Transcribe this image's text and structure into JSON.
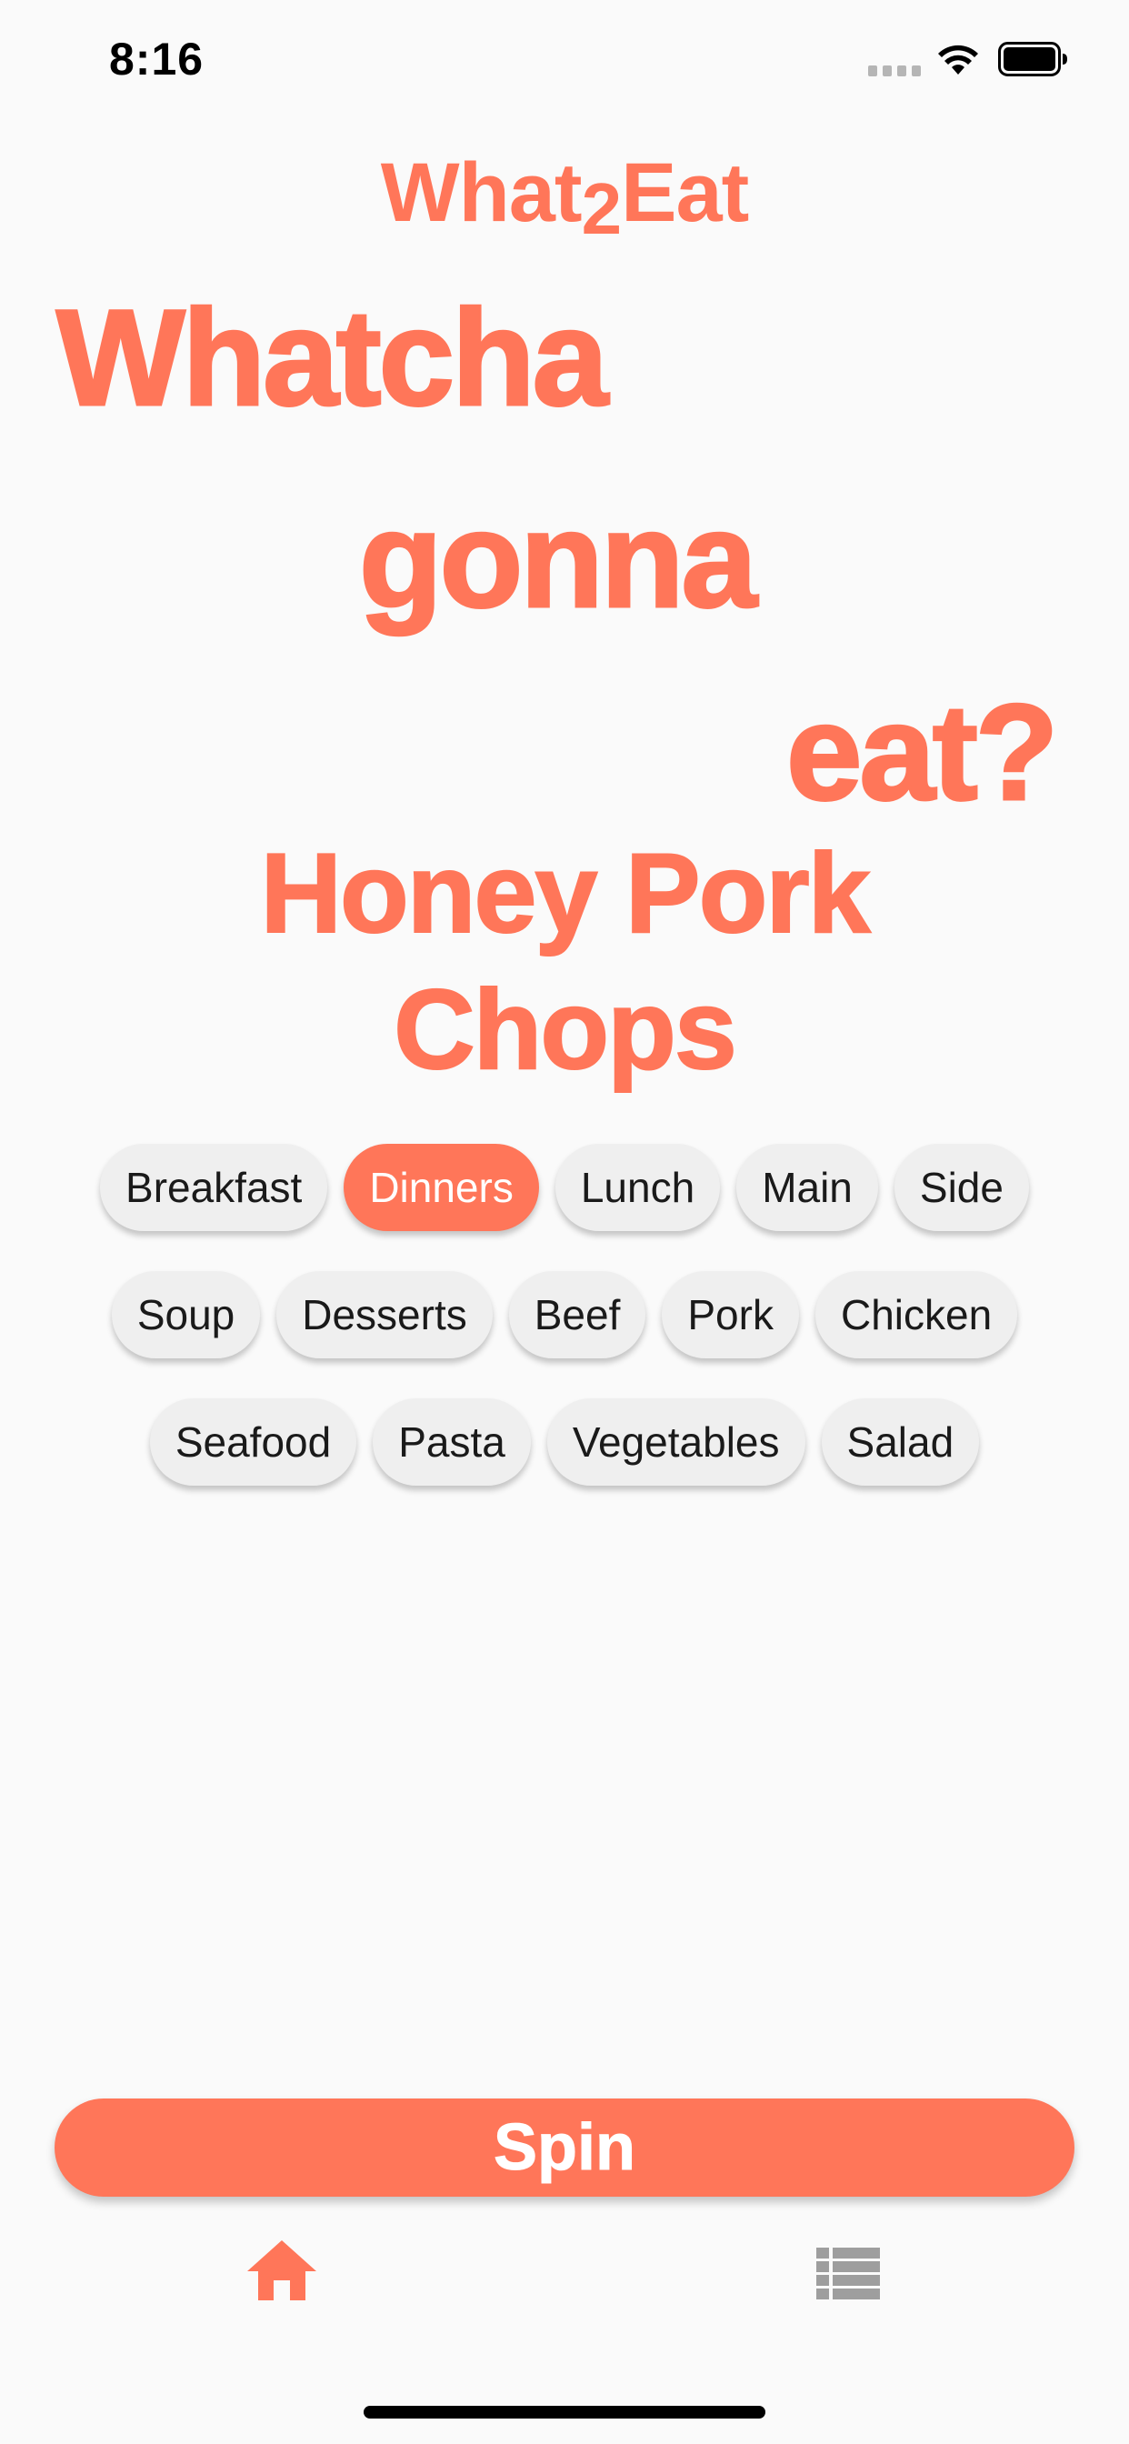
{
  "status_bar": {
    "time": "8:16"
  },
  "app": {
    "logo_left": "What",
    "logo_mid": "2",
    "logo_right": "Eat",
    "accent_color": "#ff7659"
  },
  "headline": {
    "line1": "Whatcha",
    "line2": "gonna",
    "line3": "eat?"
  },
  "result": {
    "line1": "Honey Pork",
    "line2": "Chops"
  },
  "categories": {
    "row1": [
      "Breakfast",
      "Dinners",
      "Lunch",
      "Main",
      "Side"
    ],
    "row2": [
      "Soup",
      "Desserts",
      "Beef",
      "Pork",
      "Chicken"
    ],
    "row3": [
      "Seafood",
      "Pasta",
      "Vegetables",
      "Salad"
    ],
    "selected": "Dinners"
  },
  "actions": {
    "spin_label": "Spin"
  },
  "bottom_nav": {
    "items": [
      {
        "icon": "home-icon",
        "active": true
      },
      {
        "icon": "list-icon",
        "active": false
      }
    ]
  }
}
